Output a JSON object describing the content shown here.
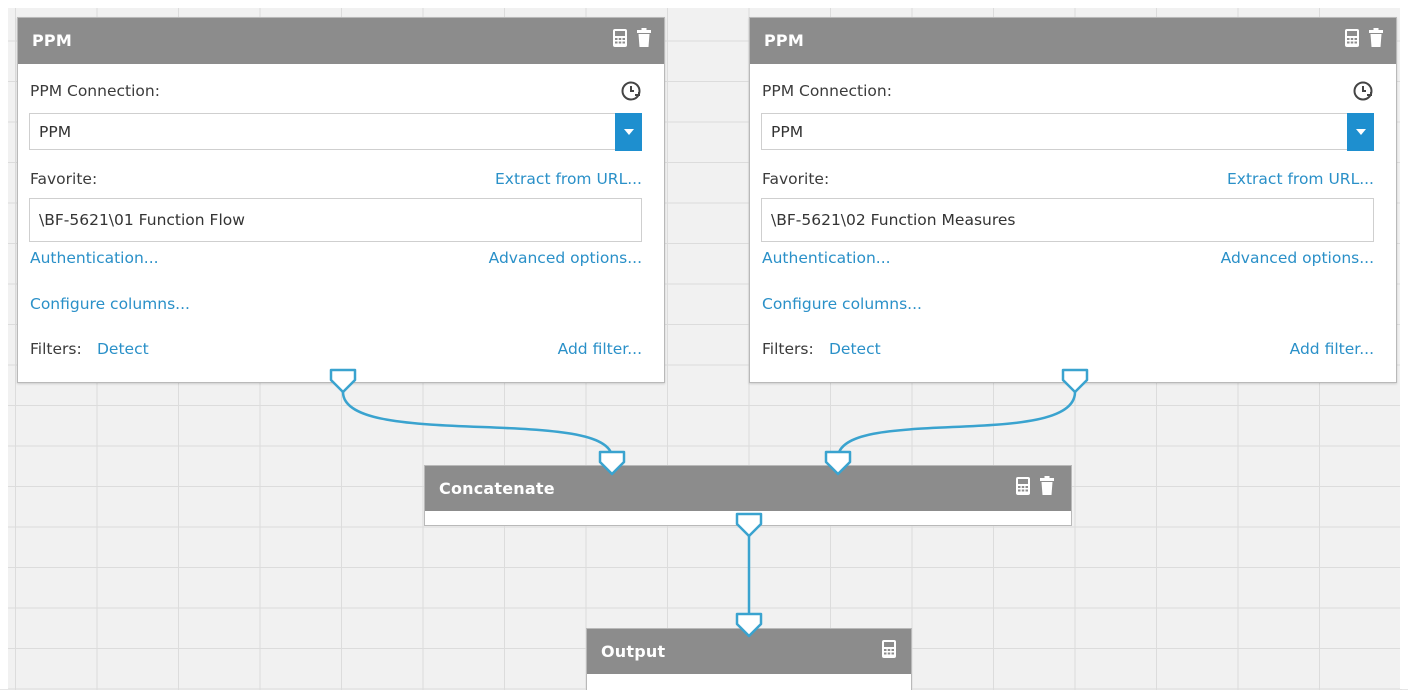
{
  "nodes": {
    "ppm1": {
      "title": "PPM",
      "connection_label": "PPM Connection:",
      "connection_value": "PPM",
      "favorite_label": "Favorite:",
      "extract_link": "Extract from URL...",
      "favorite_value": "\\BF-5621\\01 Function Flow",
      "auth_link": "Authentication...",
      "advanced_link": "Advanced options...",
      "configure_link": "Configure columns...",
      "filters_label": "Filters:",
      "detect_link": "Detect",
      "add_filter_link": "Add filter..."
    },
    "ppm2": {
      "title": "PPM",
      "connection_label": "PPM Connection:",
      "connection_value": "PPM",
      "favorite_label": "Favorite:",
      "extract_link": "Extract from URL...",
      "favorite_value": "\\BF-5621\\02 Function Measures",
      "auth_link": "Authentication...",
      "advanced_link": "Advanced options...",
      "configure_link": "Configure columns...",
      "filters_label": "Filters:",
      "detect_link": "Detect",
      "add_filter_link": "Add filter..."
    },
    "concatenate": {
      "title": "Concatenate"
    },
    "output": {
      "title": "Output"
    }
  },
  "colors": {
    "header": "#8c8c8c",
    "link": "#2a90c8",
    "wire": "#3aa3cf",
    "dropdown": "#1e8fcf"
  },
  "icons": [
    "calculator-icon",
    "trash-icon",
    "history-icon",
    "chevron-down-icon",
    "port-icon"
  ]
}
